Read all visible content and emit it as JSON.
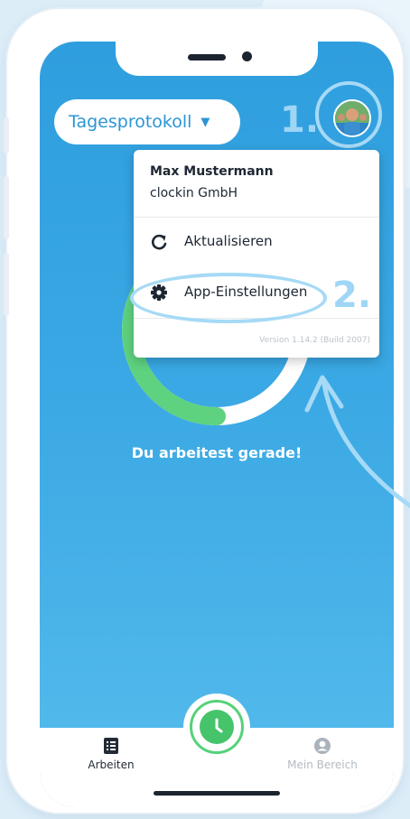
{
  "header": {
    "view_selector": "Tagesprotokoll",
    "step1_label": "1.",
    "step2_label": "2."
  },
  "menu": {
    "user_name": "Max Mustermann",
    "company": "clockin GmbH",
    "items": [
      {
        "label": "Aktualisieren",
        "icon": "refresh-icon"
      },
      {
        "label": "App-Einstellungen",
        "icon": "gear-icon"
      }
    ],
    "version": "Version 1.14.2 (Build 2007)"
  },
  "main": {
    "status_text": "Du arbeitest gerade!",
    "progress_fraction": 0.45
  },
  "bottom_nav": {
    "tabs": [
      {
        "label": "Arbeiten",
        "icon": "list-icon",
        "active": true
      },
      {
        "label": "Mein Bereich",
        "icon": "user-icon",
        "active": false
      }
    ],
    "fab_icon": "clock-icon"
  },
  "colors": {
    "primary_blue": "#2f9ede",
    "accent_green": "#46c46c",
    "highlight": "#a6daf6"
  }
}
